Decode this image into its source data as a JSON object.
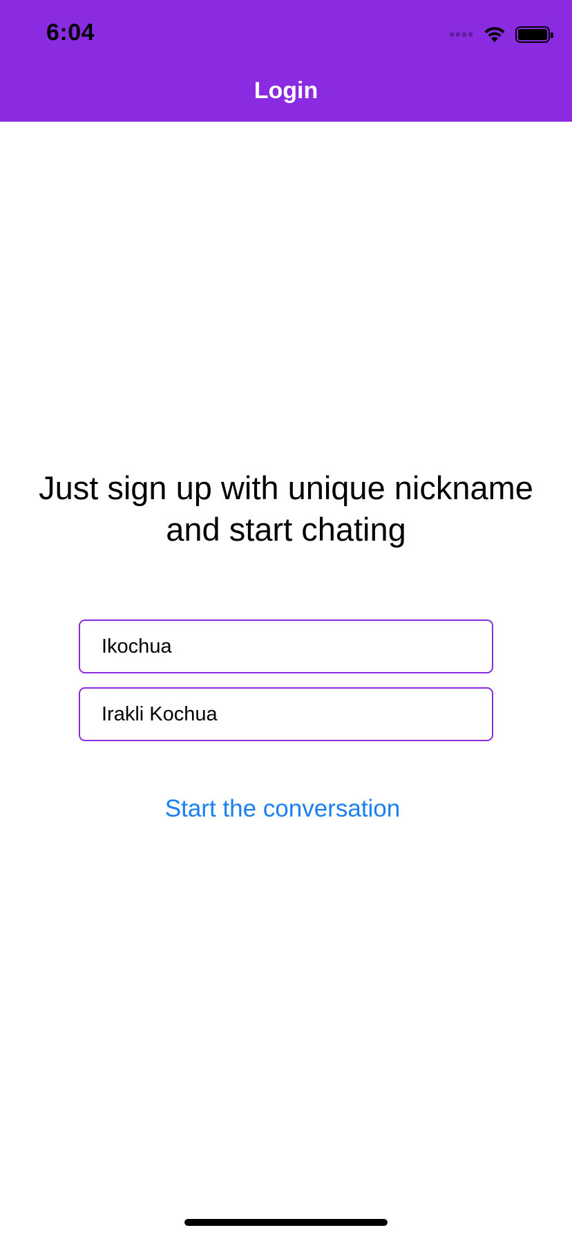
{
  "status_bar": {
    "time": "6:04",
    "icons": [
      "cellular-signal-icon",
      "wifi-icon",
      "battery-icon"
    ]
  },
  "nav": {
    "title": "Login"
  },
  "main": {
    "headline": "Just sign up with unique nickname and start chating",
    "nickname_field": {
      "value": "Ikochua"
    },
    "fullname_field": {
      "value": "Irakli Kochua"
    },
    "start_button_label": "Start the conversation"
  },
  "colors": {
    "accent": "#8a2be2",
    "link": "#1a7ff0",
    "background": "#ffffff"
  }
}
